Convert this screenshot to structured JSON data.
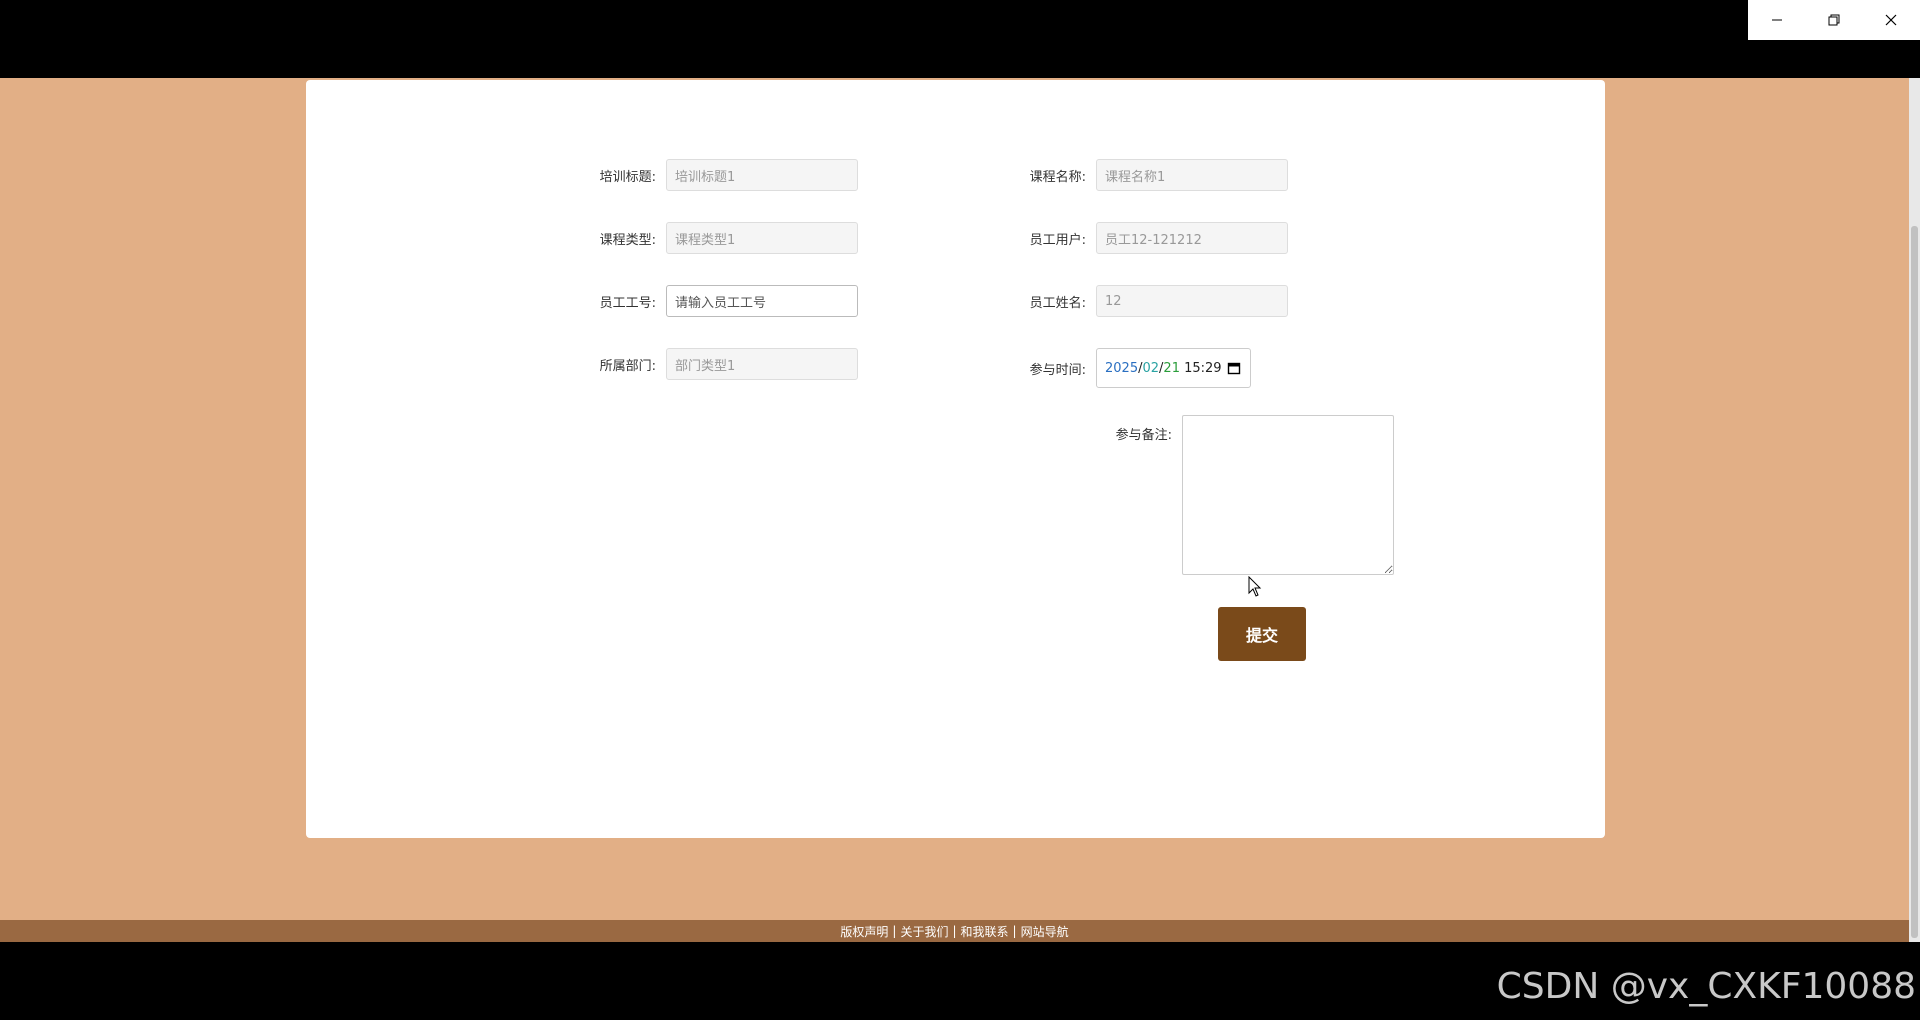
{
  "window": {
    "controls": {
      "minimize_icon": "minimize-icon",
      "restore_icon": "restore-icon",
      "close_icon": "close-icon"
    }
  },
  "form": {
    "training_title": {
      "label": "培训标题:",
      "value": "培训标题1"
    },
    "course_name": {
      "label": "课程名称:",
      "value": "课程名称1"
    },
    "course_type": {
      "label": "课程类型:",
      "value": "课程类型1"
    },
    "employee_user": {
      "label": "员工用户:",
      "value": "员工12-121212"
    },
    "employee_id": {
      "label": "员工工号:",
      "placeholder": "请输入员工工号"
    },
    "employee_name": {
      "label": "员工姓名:",
      "value": "12"
    },
    "department": {
      "label": "所属部门:",
      "value": "部门类型1"
    },
    "join_time": {
      "label": "参与时间:",
      "year": "2025",
      "month": "02",
      "day": "21",
      "time": "15:29",
      "sep": "/"
    },
    "notes": {
      "label": "参与备注:"
    },
    "submit_label": "提交"
  },
  "footer": {
    "links": [
      "版权声明",
      "关于我们",
      "和我联系",
      "网站导航"
    ],
    "separator": "|"
  },
  "watermark": "CSDN @vx_CXKF10088",
  "colors": {
    "page_bg": "#e2af86",
    "footer_bg": "#9a6942",
    "submit_bg": "#7a4a1a"
  }
}
